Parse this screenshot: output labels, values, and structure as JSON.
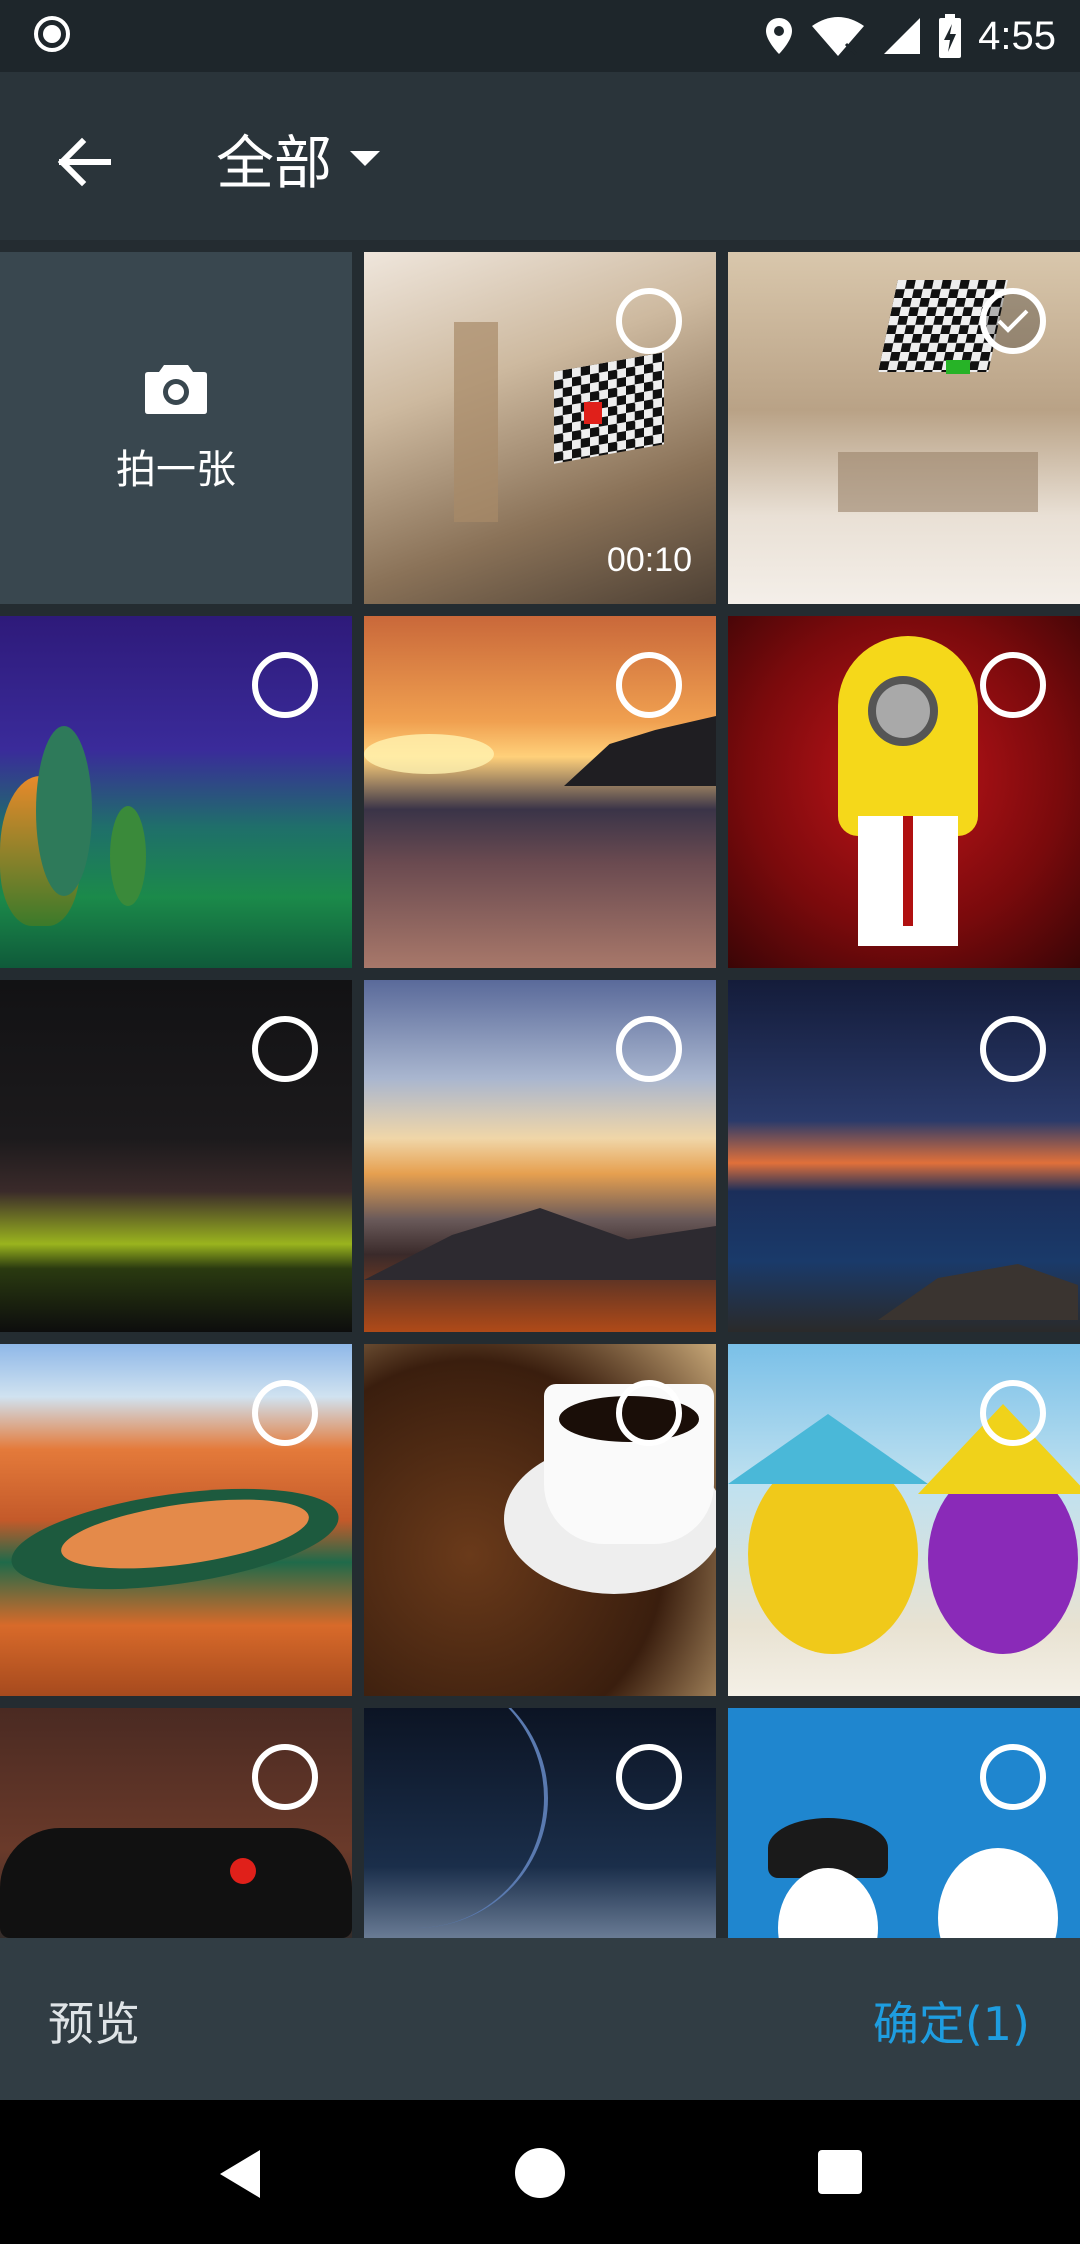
{
  "status_bar": {
    "time": "4:55"
  },
  "top_bar": {
    "title": "全部"
  },
  "camera_tile": {
    "label": "拍一张"
  },
  "grid_items": [
    {
      "kind": "video",
      "duration": "00:10",
      "selected": false
    },
    {
      "kind": "image",
      "selected": true
    },
    {
      "kind": "image",
      "selected": false
    },
    {
      "kind": "image",
      "selected": false
    },
    {
      "kind": "image",
      "selected": false
    },
    {
      "kind": "image",
      "selected": false
    },
    {
      "kind": "image",
      "selected": false
    },
    {
      "kind": "image",
      "selected": false
    },
    {
      "kind": "image",
      "selected": false
    },
    {
      "kind": "image",
      "selected": false
    },
    {
      "kind": "image",
      "selected": false
    },
    {
      "kind": "image",
      "selected": false
    },
    {
      "kind": "image",
      "selected": false
    },
    {
      "kind": "image",
      "selected": false
    }
  ],
  "bottom_bar": {
    "preview_label": "预览",
    "confirm_label": "确定(1)"
  },
  "colors": {
    "accent": "#1e9de0",
    "toolbar": "#2a343a",
    "background": "#242c31"
  }
}
